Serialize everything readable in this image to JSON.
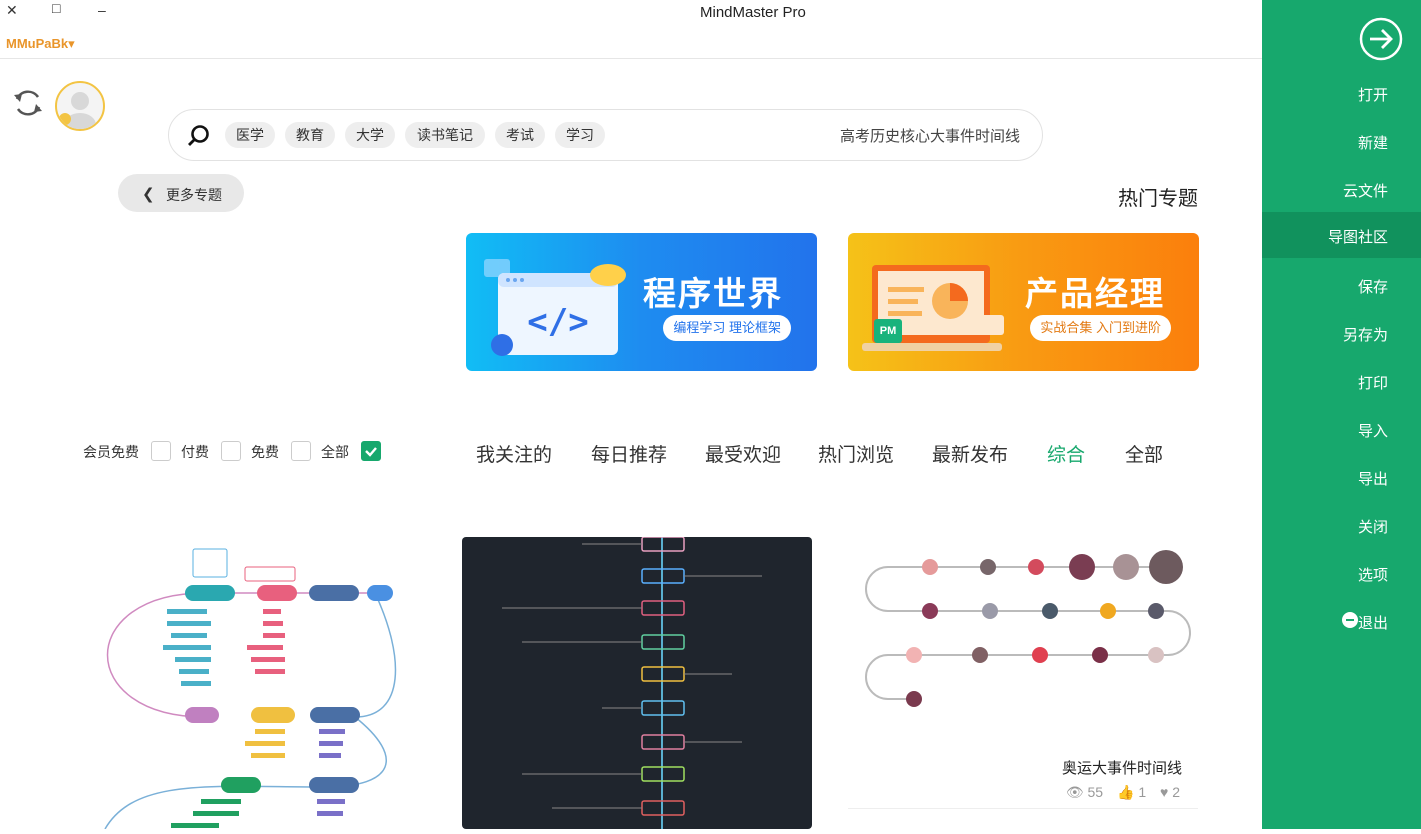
{
  "window": {
    "title": "MindMaster Pro",
    "close": "✕",
    "maximize": "□",
    "minimize": "–"
  },
  "account": {
    "name": "MMuPaBk▾"
  },
  "search": {
    "placeholder": "高考历史核心大事件时间线",
    "tags": [
      "学习",
      "考试",
      "读书笔记",
      "大学",
      "教育",
      "医学"
    ]
  },
  "hot_topics": {
    "title": "热门专题",
    "more": "更多专题",
    "banners": [
      {
        "title": "产品经理",
        "subtitle": "实战合集 入门到进阶",
        "badge": "PM"
      },
      {
        "title": "程序世界",
        "subtitle": "编程学习 理论框架"
      }
    ]
  },
  "filters": {
    "tabs": [
      "全部",
      "综合",
      "最新发布",
      "热门浏览",
      "最受欢迎",
      "每日推荐",
      "我关注的"
    ],
    "active_tab": "综合",
    "price": [
      {
        "label": "全部",
        "checked": true
      },
      {
        "label": "免费",
        "checked": false
      },
      {
        "label": "付费",
        "checked": false
      },
      {
        "label": "会员免费",
        "checked": false
      }
    ]
  },
  "cards": [
    {
      "title": "奥运大事件时间线",
      "views": "55",
      "likes": "1",
      "favorites": "2"
    }
  ],
  "sidebar": {
    "items": [
      "打开",
      "新建",
      "云文件",
      "导图社区",
      "保存",
      "另存为",
      "打印",
      "导入",
      "导出",
      "关闭",
      "选项",
      "退出"
    ],
    "active": "导图社区"
  },
  "colors": {
    "accent": "#17a86d",
    "account": "#e9952a",
    "banner_pm": "#f99a12",
    "banner_code": "#1e8cf0"
  }
}
